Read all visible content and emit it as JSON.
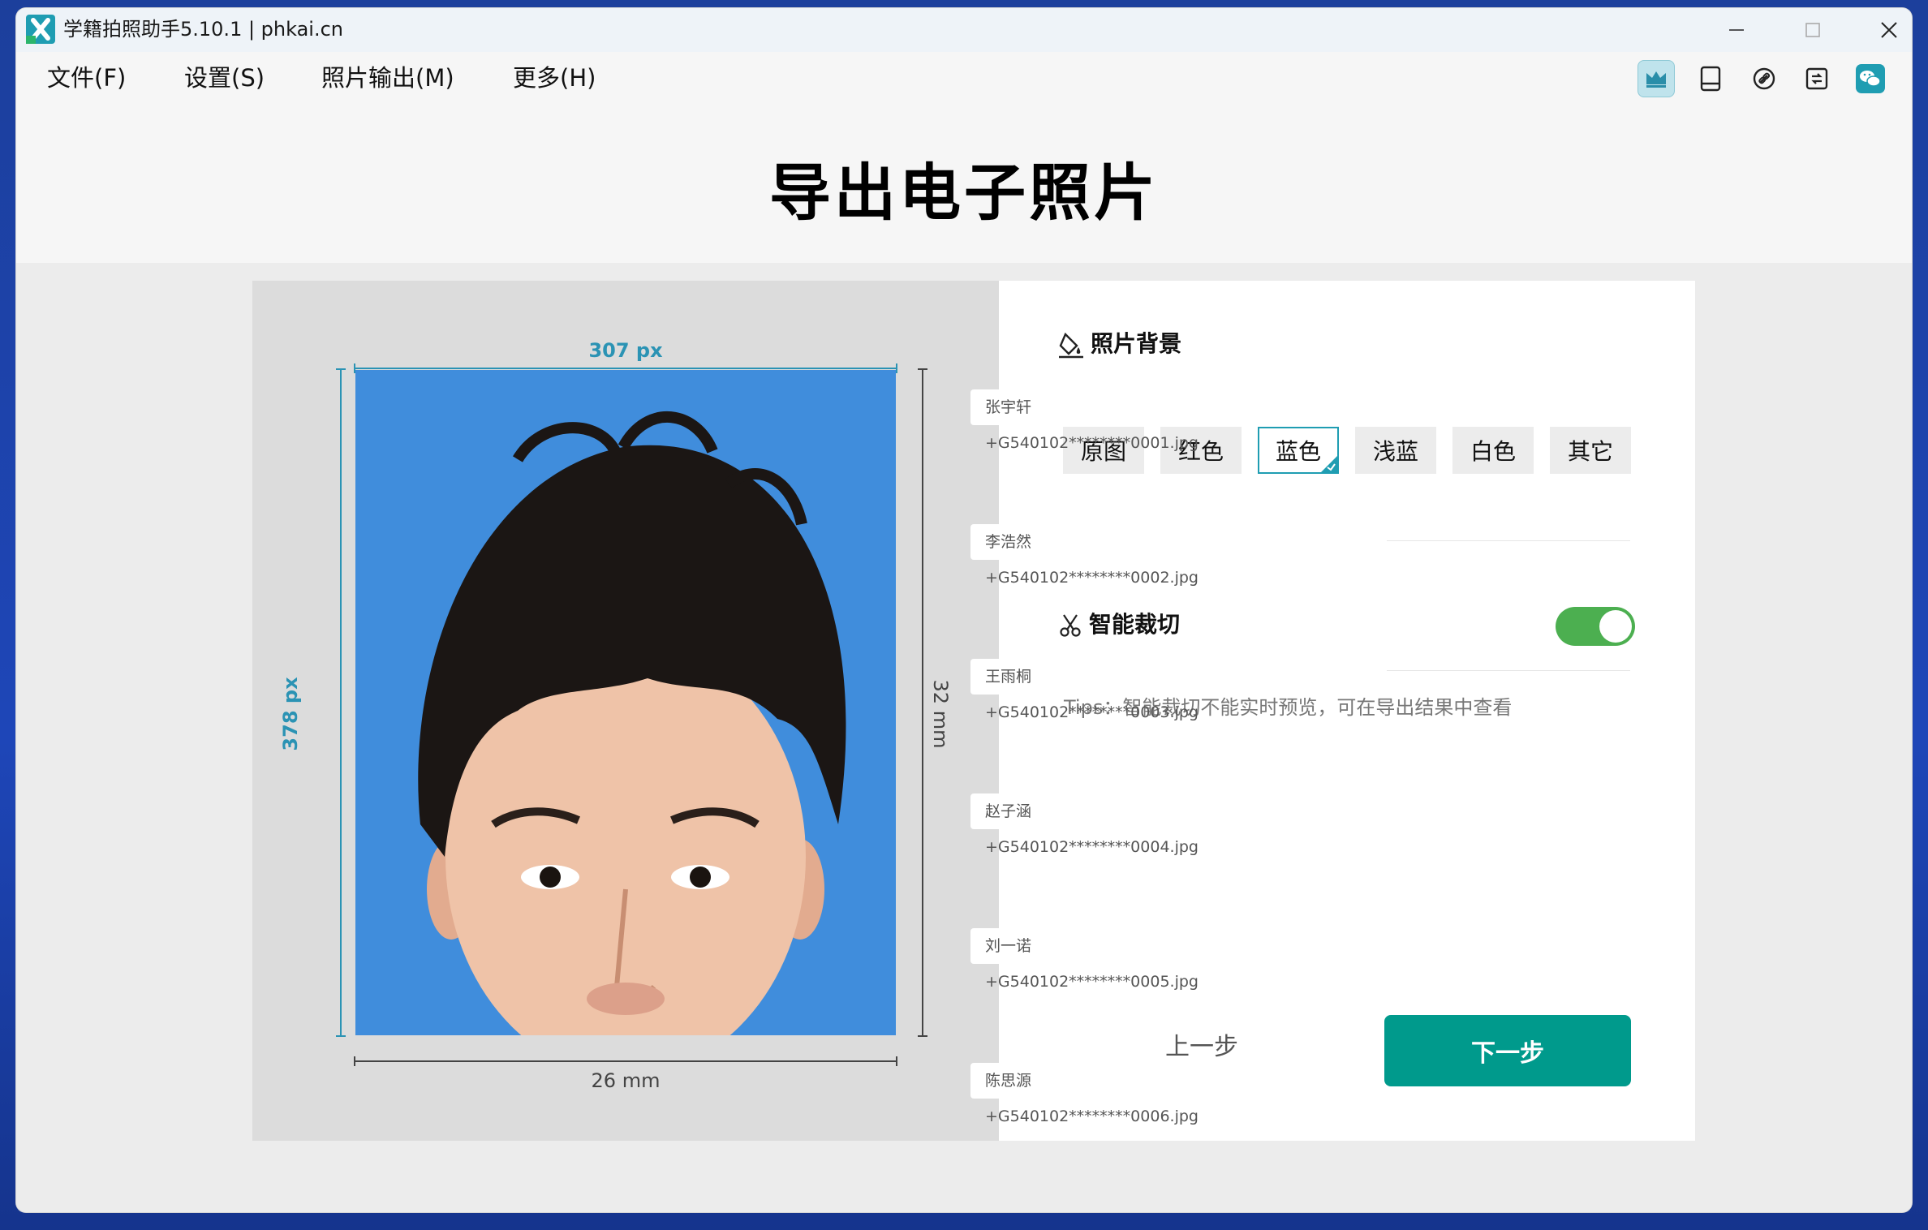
{
  "app": {
    "title": "学籍拍照助手5.10.1 | phkai.cn",
    "accent_color": "#009a8c",
    "logo_icon": "app-logo-x"
  },
  "window_controls": [
    "minimize-icon",
    "maximize-icon",
    "close-icon"
  ],
  "menu": {
    "items": [
      {
        "label": "文件(F)"
      },
      {
        "label": "设置(S)"
      },
      {
        "label": "照片输出(M)"
      },
      {
        "label": "更多(H)"
      }
    ]
  },
  "toolbar": {
    "icons": [
      "crown-icon",
      "tablet-icon",
      "link-icon",
      "swap-icon",
      "wechat-icon"
    ],
    "active_index": 0
  },
  "page": {
    "title": "导出电子照片"
  },
  "preview": {
    "width_px": "307 px",
    "height_px": "378 px",
    "width_mm": "26 mm",
    "height_mm": "32 mm",
    "background_color": "#408ddc"
  },
  "files": [
    "张宇轩+G540102********0001.jpg",
    "李浩然+G540102********0002.jpg",
    "王雨桐+G540102********0003.jpg",
    "赵子涵+G540102********0004.jpg",
    "刘一诺+G540102********0005.jpg",
    "陈思源+G540102********0006.jpg"
  ],
  "settings": {
    "background_section": {
      "title": "照片背景",
      "options": [
        "原图",
        "红色",
        "蓝色",
        "浅蓝",
        "白色",
        "其它"
      ],
      "selected": "蓝色"
    },
    "crop_section": {
      "title": "智能裁切",
      "enabled": true,
      "tips": "Tips：智能裁切不能实时预览，可在导出结果中查看"
    },
    "prev_label": "上一步",
    "next_label": "下一步"
  }
}
